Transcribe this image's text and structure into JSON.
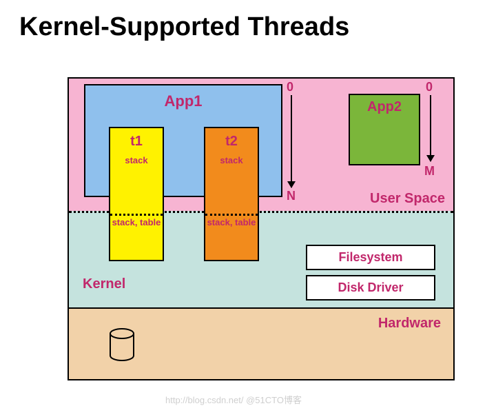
{
  "title": "Kernel-Supported Threads",
  "user_space": {
    "label": "User Space",
    "app1": {
      "label": "App1",
      "addrTop": "0",
      "addrBottom": "N",
      "threads": {
        "t1": {
          "name": "t1",
          "stack": "stack",
          "kernelPart": "stack,\ntable"
        },
        "t2": {
          "name": "t2",
          "stack": "stack",
          "kernelPart": "stack,\ntable"
        }
      }
    },
    "app2": {
      "label": "App2",
      "addrTop": "0",
      "addrBottom": "M"
    }
  },
  "kernel": {
    "label": "Kernel",
    "modules": {
      "filesystem": "Filesystem",
      "diskdriver": "Disk Driver"
    }
  },
  "hardware": {
    "label": "Hardware"
  },
  "watermark": "http://blog.csdn.net/  @51CTO博客"
}
